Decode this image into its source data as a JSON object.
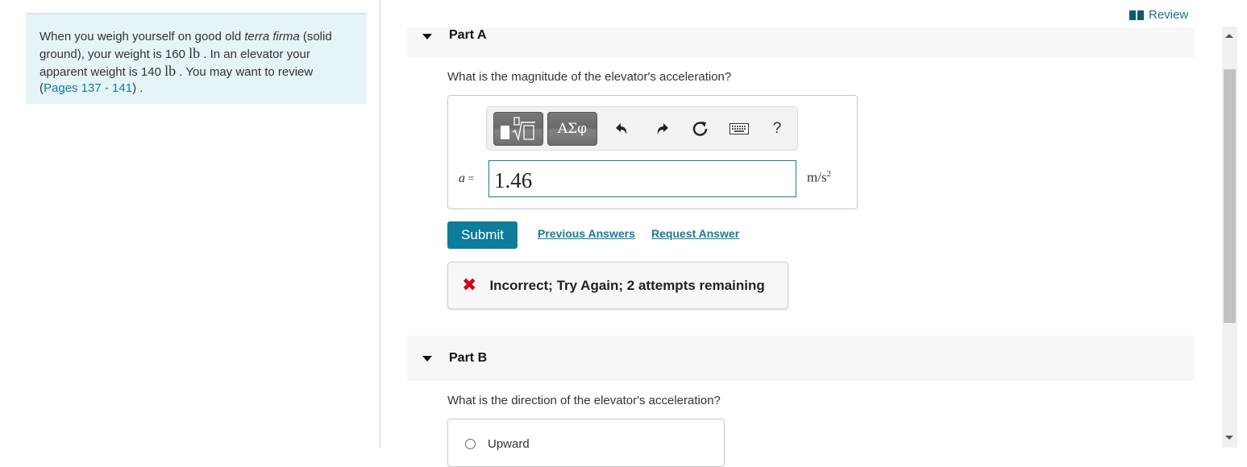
{
  "intro": {
    "text_1": "When you weigh yourself on good old ",
    "text_italic": "terra firma",
    "text_2": " (solid ground), your weight is 160 ",
    "unit_lb": "lb",
    "text_3": " . In an elevator your apparent weight is 140 ",
    "text_4": " . You may want to review (",
    "link": "Pages 137 - 141",
    "text_5": ") ."
  },
  "review": {
    "icon": "book-icon",
    "label": "Review"
  },
  "part_a": {
    "title": "Part A",
    "question": "What is the magnitude of the elevator's acceleration?",
    "toolbar": {
      "templates_icon": "templates-icon",
      "greek_label": "ΑΣφ",
      "undo_icon": "undo-icon",
      "redo_icon": "redo-icon",
      "reset_icon": "reset-icon",
      "keyboard_icon": "keyboard-icon",
      "help_label": "?"
    },
    "variable": "a",
    "equals": "=",
    "answer_value": "1.46",
    "units": "m/s",
    "units_exp": "2",
    "submit_label": "Submit",
    "previous_answers_label": "Previous Answers",
    "request_answer_label": "Request Answer",
    "feedback": {
      "icon": "x-icon",
      "symbol": "✖",
      "message": "Incorrect; Try Again; 2 attempts remaining",
      "color": "#d0021b"
    }
  },
  "part_b": {
    "title": "Part B",
    "question": "What is the direction of the elevator's acceleration?",
    "options": [
      {
        "label": "Upward",
        "selected": false
      }
    ]
  },
  "colors": {
    "accent": "#0e7c9b",
    "link": "#1a7a96",
    "intro_bg": "#e5f4f6"
  }
}
